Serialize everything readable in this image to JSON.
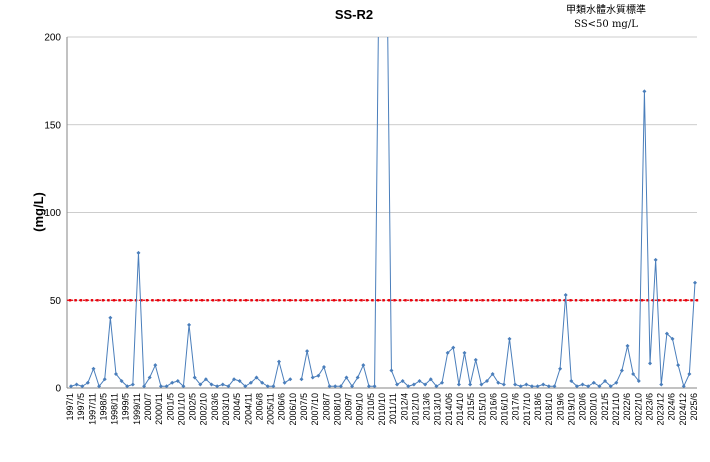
{
  "chart_data": {
    "type": "line",
    "title": "SS-R2",
    "annotation": [
      "甲類水體水質標準",
      "SS<50 mg/L"
    ],
    "ylabel": "(mg/L)",
    "xlabel": "",
    "ylim": [
      0,
      200
    ],
    "yticks": [
      0,
      50,
      100,
      150,
      200
    ],
    "grid": true,
    "colors": {
      "series": "#4a7ebb",
      "standard": "#e8000b",
      "grid": "#bcbcbc"
    },
    "tick_labels": [
      "1997/1",
      "1997/5",
      "1997/11",
      "1998/5",
      "1998/11",
      "1999/5",
      "1999/11",
      "2000/7",
      "2000/11",
      "2001/5",
      "2001/10",
      "2002/5",
      "2002/10",
      "2003/6",
      "2003/10",
      "2004/5",
      "2004/11",
      "2006/8",
      "2005/11",
      "2006/6",
      "2006/10",
      "2007/5",
      "2007/10",
      "2008/7",
      "2008/10",
      "2009/7",
      "2009/10",
      "2010/5",
      "2010/10",
      "2011/11",
      "2012/4",
      "2012/10",
      "2013/6",
      "2013/10",
      "2014/06",
      "2014/10",
      "2015/5",
      "2015/10",
      "2016/6",
      "2016/10",
      "2017/6",
      "2017/10",
      "2018/6",
      "2018/10",
      "2019/6",
      "2019/10",
      "2020/6",
      "2020/10",
      "2021/5",
      "2021/10",
      "2022/6",
      "2022/10",
      "2023/6",
      "2023/12",
      "2024/6",
      "2024/12",
      "2025/6"
    ],
    "standard": {
      "value": 50
    },
    "series": [
      {
        "values": [
          1,
          2,
          1,
          3,
          11,
          1,
          5,
          40,
          8,
          4,
          1,
          2,
          77,
          1,
          6,
          13,
          1,
          1,
          3,
          4,
          1,
          36,
          6,
          2,
          5,
          2,
          1,
          2,
          1,
          5,
          4,
          1,
          3,
          6,
          3,
          1,
          1,
          15,
          3,
          5,
          null,
          5,
          21,
          6,
          7,
          12,
          1,
          1,
          1,
          6,
          1,
          6,
          13,
          1,
          1,
          300,
          300,
          10,
          2,
          4,
          1,
          2,
          4,
          2,
          5,
          1,
          3,
          20,
          23,
          2,
          20,
          2,
          16,
          2,
          4,
          8,
          3,
          2,
          28,
          2,
          1,
          2,
          1,
          1,
          2,
          1,
          1,
          11,
          53,
          4,
          1,
          2,
          1,
          3,
          1,
          4,
          1,
          3,
          10,
          24,
          8,
          4,
          169,
          14,
          73,
          2,
          31,
          28,
          13,
          1,
          8,
          60
        ]
      }
    ]
  }
}
